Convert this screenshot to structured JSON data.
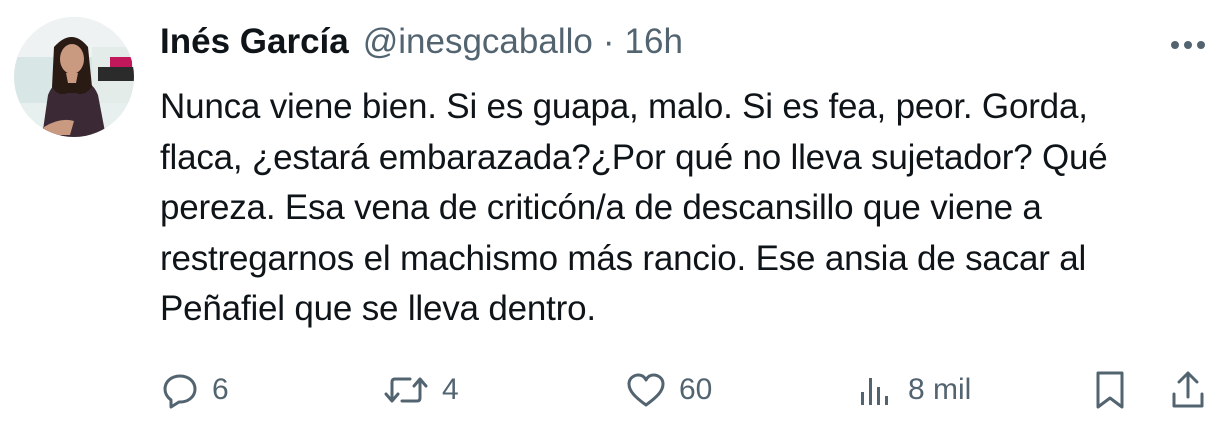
{
  "tweet": {
    "author": {
      "display_name": "Inés García",
      "handle": "@inesgcaballo",
      "separator": "·",
      "time": "16h"
    },
    "text_lines": [
      "Nunca viene bien. Si es guapa, malo. Si es fea, peor. Gorda,",
      "flaca, ¿estará embarazada?¿Por qué no lleva sujetador? Qué",
      "pereza. Esa vena de criticón/a de descansillo que viene a",
      "restregarnos el machismo más rancio. Ese ansia de sacar al",
      "Peñafiel que se lleva dentro."
    ],
    "actions": {
      "reply": {
        "icon": "reply-icon",
        "count": "6"
      },
      "retweet": {
        "icon": "retweet-icon",
        "count": "4"
      },
      "like": {
        "icon": "heart-icon",
        "count": "60"
      },
      "views": {
        "icon": "views-icon",
        "count": "8 mil"
      },
      "bookmark": {
        "icon": "bookmark-icon"
      },
      "share": {
        "icon": "share-icon"
      }
    }
  },
  "colors": {
    "text_primary": "#0f1419",
    "text_secondary": "#536471",
    "background": "#ffffff"
  }
}
